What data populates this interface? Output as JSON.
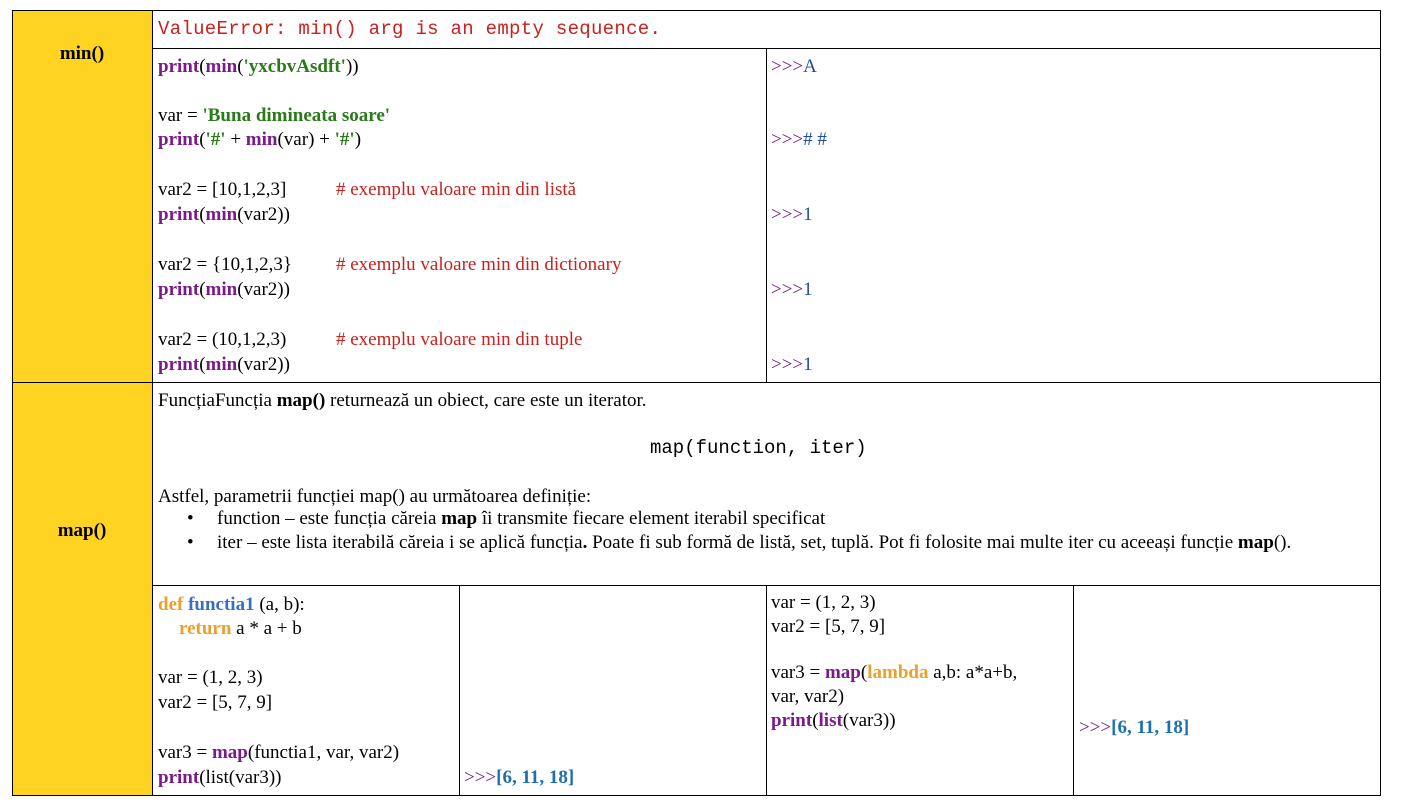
{
  "rows": {
    "min": {
      "label": "min()",
      "error": "ValueError: min() arg is an empty sequence.",
      "code": {
        "l1_fn": "print",
        "l1_a": "(",
        "l1_fn2": "min",
        "l1_b": "(",
        "l1_str": "'yxcbvAsdft'",
        "l1_c": "))",
        "l2_a": "var = ",
        "l2_str": "'Buna dimineata soare'",
        "l3_fn": "print",
        "l3_a": "(",
        "l3_str1": "'#'",
        "l3_b": " + ",
        "l3_fn2": "min",
        "l3_c": "(var) + ",
        "l3_str2": "'#'",
        "l3_d": ")",
        "l4_a": "var2 = [10,1,2,3]",
        "l4_cm": "# exemplu valoare min din listă",
        "l5_fn": "print",
        "l5_a": "(",
        "l5_fn2": "min",
        "l5_b": "(var2))",
        "l6_a": "var2 = {10,1,2,3}",
        "l6_cm": "# exemplu valoare min din dictionary",
        "l7_fn": "print",
        "l7_a": "(",
        "l7_fn2": "min",
        "l7_b": "(var2))",
        "l8_a": "var2 = (10,1,2,3)",
        "l8_cm": "# exemplu valoare min din tuple",
        "l9_fn": "print",
        "l9_a": "(",
        "l9_fn2": "min",
        "l9_b": "(var2))"
      },
      "outputs": {
        "prompt": ">>>",
        "o1": "A",
        "o2": "# #",
        "o3": "1",
        "o4": "1",
        "o5": "1"
      }
    },
    "map": {
      "label": "map()",
      "desc_a": "FuncțiaFuncția ",
      "desc_b": "map()",
      "desc_c": " returnează un obiect, care este un iterator.",
      "signature": "map(function, iter)",
      "params_intro": "Astfel, parametrii funcției map() au următoarea definiție:",
      "b1_a": "function – este funcția căreia ",
      "b1_b": "map",
      "b1_c": " îi transmite fiecare element iterabil specificat",
      "b2_a": "iter – este lista iterabilă căreia i se aplică funcția",
      "b2_b": ".",
      "b2_c": " Poate fi sub formă de listă, set, tuplă. Pot fi folosite mai multe iter cu aceeași funcție ",
      "b2_d": "map",
      "b2_e": "().",
      "ex1": {
        "l1_def": "def",
        "l1_fn": "functia1",
        "l1_a": " (a, b):",
        "l2_ret": "return",
        "l2_a": " a * a + b",
        "l3": "var = (1, 2, 3)",
        "l4": "var2 = [5, 7, 9]",
        "l5_a": "var3 = ",
        "l5_fn": "map",
        "l5_b": "(functia1, var, var2)",
        "l6_fn": "print",
        "l6_a": "(list(var3))",
        "out_prompt": ">>>",
        "out_val": "[6, 11, 18]"
      },
      "ex2": {
        "l1": "var = (1, 2, 3)",
        "l2": "var2 = [5, 7, 9]",
        "l3_a": "var3 = ",
        "l3_fn": "map",
        "l3_b": "(",
        "l3_kw": "lambda",
        "l3_c": " a,b: a*a+b,",
        "l4": "var, var2)",
        "l5_fn": "print",
        "l5_a": "(",
        "l5_fn2": "list",
        "l5_b": "(var3))",
        "out_prompt": ">>>",
        "out_val": "[6, 11, 18]"
      }
    }
  },
  "colors": {
    "label_bg": "#ffd322",
    "keyword": "#7b1a8a",
    "string": "#2a7a1a",
    "comment": "#c9211e",
    "def": "#e8a22a",
    "function_name": "#3a6fc0",
    "output": "#1e6fae"
  }
}
